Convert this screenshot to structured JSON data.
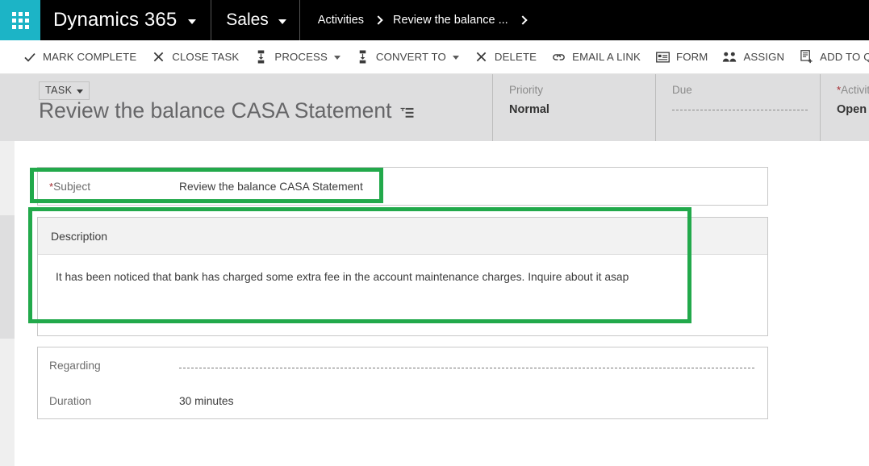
{
  "topnav": {
    "waffle_icon": "waffle-grid-icon",
    "brand": "Dynamics 365",
    "brand_caret_icon": "chevron-down-icon",
    "area": "Sales",
    "area_caret_icon": "chevron-down-icon",
    "breadcrumb": [
      {
        "label": "Activities"
      },
      {
        "label": "Review the balance ..."
      }
    ],
    "breadcrumb_sep_icon": "chevron-right-icon"
  },
  "commandbar": {
    "items": [
      {
        "label": "MARK COMPLETE",
        "icon": "checkmark-icon",
        "has_dropdown": false
      },
      {
        "label": "CLOSE TASK",
        "icon": "close-x-icon",
        "has_dropdown": false
      },
      {
        "label": "PROCESS",
        "icon": "process-flow-icon",
        "has_dropdown": true
      },
      {
        "label": "CONVERT TO",
        "icon": "process-flow-icon",
        "has_dropdown": true
      },
      {
        "label": "DELETE",
        "icon": "close-x-icon",
        "has_dropdown": false
      },
      {
        "label": "EMAIL A LINK",
        "icon": "link-chain-icon",
        "has_dropdown": false
      },
      {
        "label": "FORM",
        "icon": "form-icon",
        "has_dropdown": false
      },
      {
        "label": "ASSIGN",
        "icon": "people-icon",
        "has_dropdown": false
      },
      {
        "label": "ADD TO QUEUE",
        "icon": "add-to-queue-icon",
        "has_dropdown": false
      }
    ],
    "overflow_label": "•••",
    "overflow_icon": "ellipsis-icon"
  },
  "record_header": {
    "entity_chip": "TASK",
    "entity_chip_caret_icon": "chevron-down-icon",
    "title": "Review the balance CASA Statement",
    "title_icon": "sort-list-icon",
    "fields": [
      {
        "label": "Priority",
        "value": "Normal",
        "required": false,
        "empty": false
      },
      {
        "label": "Due",
        "value": "",
        "required": false,
        "empty": true
      },
      {
        "label": "Activity",
        "value": "Open",
        "required": true,
        "empty": false
      }
    ]
  },
  "form": {
    "subject": {
      "label": "Subject",
      "required": true,
      "value": "Review the balance CASA Statement"
    },
    "description": {
      "header": "Description",
      "value": "It has been noticed that bank has charged some extra fee in the account maintenance charges. Inquire about it asap"
    },
    "regarding": {
      "label": "Regarding",
      "value": "",
      "empty": true
    },
    "duration": {
      "label": "Duration",
      "value": "30 minutes"
    }
  },
  "highlights": [
    {
      "name": "subject-highlight",
      "color": "#22a94b"
    },
    {
      "name": "description-highlight",
      "color": "#22a94b"
    }
  ],
  "colors": {
    "nav_background": "#000000",
    "waffle_background": "#1cb4c6",
    "header_background": "#dededf",
    "highlight_green": "#22a94b",
    "required_red": "#a4262c"
  }
}
